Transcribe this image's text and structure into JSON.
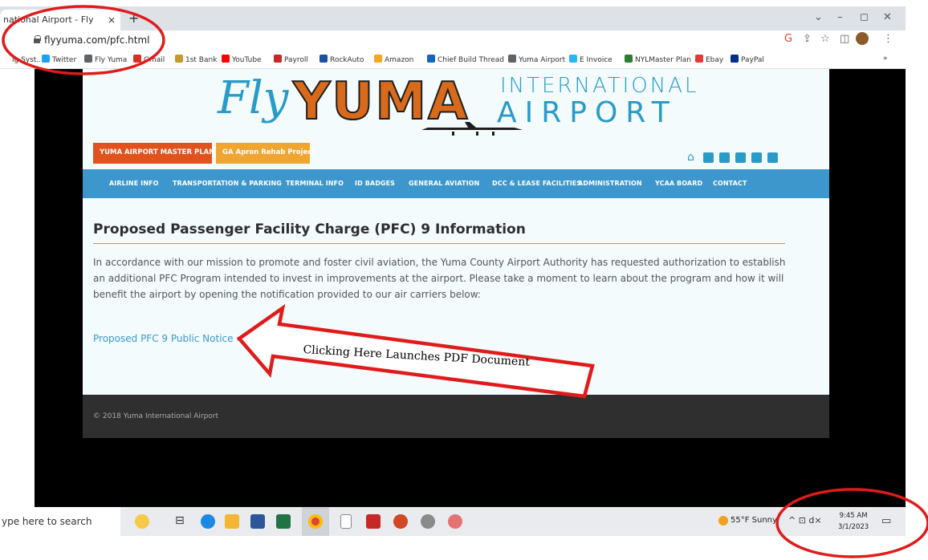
{
  "browser": {
    "tab_title": "national Airport - Fly",
    "tab_close": "×",
    "new_tab": "+",
    "url": "flyyuma.com/pfc.html",
    "window_controls": {
      "dropdown": "⌄",
      "minimize": "–",
      "restore": "◻",
      "close": "✕"
    },
    "bookmarks": [
      {
        "label": "ig Syst...",
        "color": "#ffffff"
      },
      {
        "label": "Twitter",
        "color": "#1da1f2"
      },
      {
        "label": "Fly Yuma",
        "color": "#5f6368"
      },
      {
        "label": "Gmail",
        "color": "#d93025"
      },
      {
        "label": "1st Bank",
        "color": "#c59b2e"
      },
      {
        "label": "YouTube",
        "color": "#ff0000"
      },
      {
        "label": "Payroll",
        "color": "#c62828"
      },
      {
        "label": "RockAuto",
        "color": "#1e4fa3"
      },
      {
        "label": "Amazon",
        "color": "#f5a623"
      },
      {
        "label": "Chief Build Thread",
        "color": "#1565c0"
      },
      {
        "label": "Yuma Airport",
        "color": "#5f6368"
      },
      {
        "label": "E Invoice",
        "color": "#29b6f6"
      },
      {
        "label": "NYLMaster Plan",
        "color": "#2e7d32"
      },
      {
        "label": "Ebay",
        "color": "#e53935"
      },
      {
        "label": "PayPal",
        "color": "#003087"
      }
    ],
    "bookmarks_overflow": "»"
  },
  "site": {
    "logo": {
      "fly": "Fly",
      "yuma": "YUMA",
      "international": "INTERNATIONAL",
      "airport": "AIRPORT"
    },
    "banners": [
      {
        "label": "YUMA AIRPORT MASTER PLAN",
        "color": "#e2521d"
      },
      {
        "label": "GA Apron Rehab Project",
        "color": "#f0a530"
      }
    ],
    "social_icons": [
      "home-icon",
      "camera-icon",
      "tv-icon",
      "facebook-icon",
      "twitter-icon",
      "linkedin-icon"
    ],
    "nav": [
      "AIRLINE INFO",
      "TRANSPORTATION & PARKING",
      "TERMINAL INFO",
      "ID BADGES",
      "GENERAL AVIATION",
      "DCC & LEASE FACILITIES",
      "ADMINISTRATION",
      "YCAA BOARD",
      "CONTACT"
    ],
    "heading": "Proposed Passenger Facility Charge (PFC) 9 Information",
    "body": "In accordance with our mission to promote and foster civil aviation, the Yuma County Airport Authority has requested authorization to establish an additional PFC Program intended to invest in improvements at the airport. Please take a moment to learn about the program and how it will benefit the airport by opening the notification provided to our air carriers below:",
    "notice_link": "Proposed PFC 9 Public Notice ›",
    "copyright": "© 2018 Yuma International Airport",
    "accent_color": "#3d97cd"
  },
  "annotation": {
    "callout": "Clicking Here Launches PDF Document",
    "color": "#e01b1b"
  },
  "taskbar": {
    "search_placeholder": "ype here to search",
    "weather": "55°F  Sunny",
    "tray": "^  ⊡  d×",
    "time": "9:45 AM",
    "date": "3/1/2023"
  }
}
